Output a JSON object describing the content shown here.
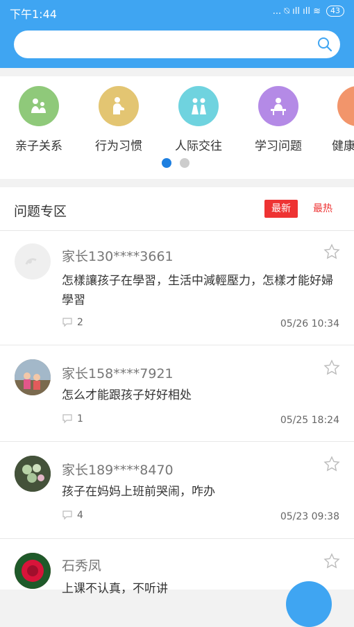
{
  "status": {
    "time": "下午1:44",
    "icons": "... ⍉ ıll ıll ≋",
    "battery": "43"
  },
  "search": {
    "placeholder": ""
  },
  "categories": [
    {
      "label": "亲子关系",
      "color": "#8fc97a",
      "icon": "parent-child-icon"
    },
    {
      "label": "行为习惯",
      "color": "#e3c572",
      "icon": "reading-icon"
    },
    {
      "label": "人际交往",
      "color": "#6fd3df",
      "icon": "people-icon"
    },
    {
      "label": "学习问题",
      "color": "#b48ae6",
      "icon": "study-desk-icon"
    },
    {
      "label": "健康",
      "color": "#f2956b",
      "icon": "health-icon"
    }
  ],
  "pager": {
    "total": 2,
    "active": 1
  },
  "section": {
    "title": "问题专区",
    "tab_new": "最新",
    "tab_hot": "最热"
  },
  "posts": [
    {
      "user": "家长130****3661",
      "text": "怎樣讓孩子在學習，生活中減輕壓力，怎樣才能好婦學習",
      "comments": "2",
      "date": "05/26 10:34"
    },
    {
      "user": "家长158****7921",
      "text": "怎么才能跟孩子好好相处",
      "comments": "1",
      "date": "05/25 18:24"
    },
    {
      "user": "家长189****8470",
      "text": "孩子在妈妈上班前哭闹，咋办",
      "comments": "4",
      "date": "05/23 09:38"
    },
    {
      "user": "石秀凤",
      "text": "上课不认真，不听讲",
      "comments": "",
      "date": ""
    }
  ]
}
